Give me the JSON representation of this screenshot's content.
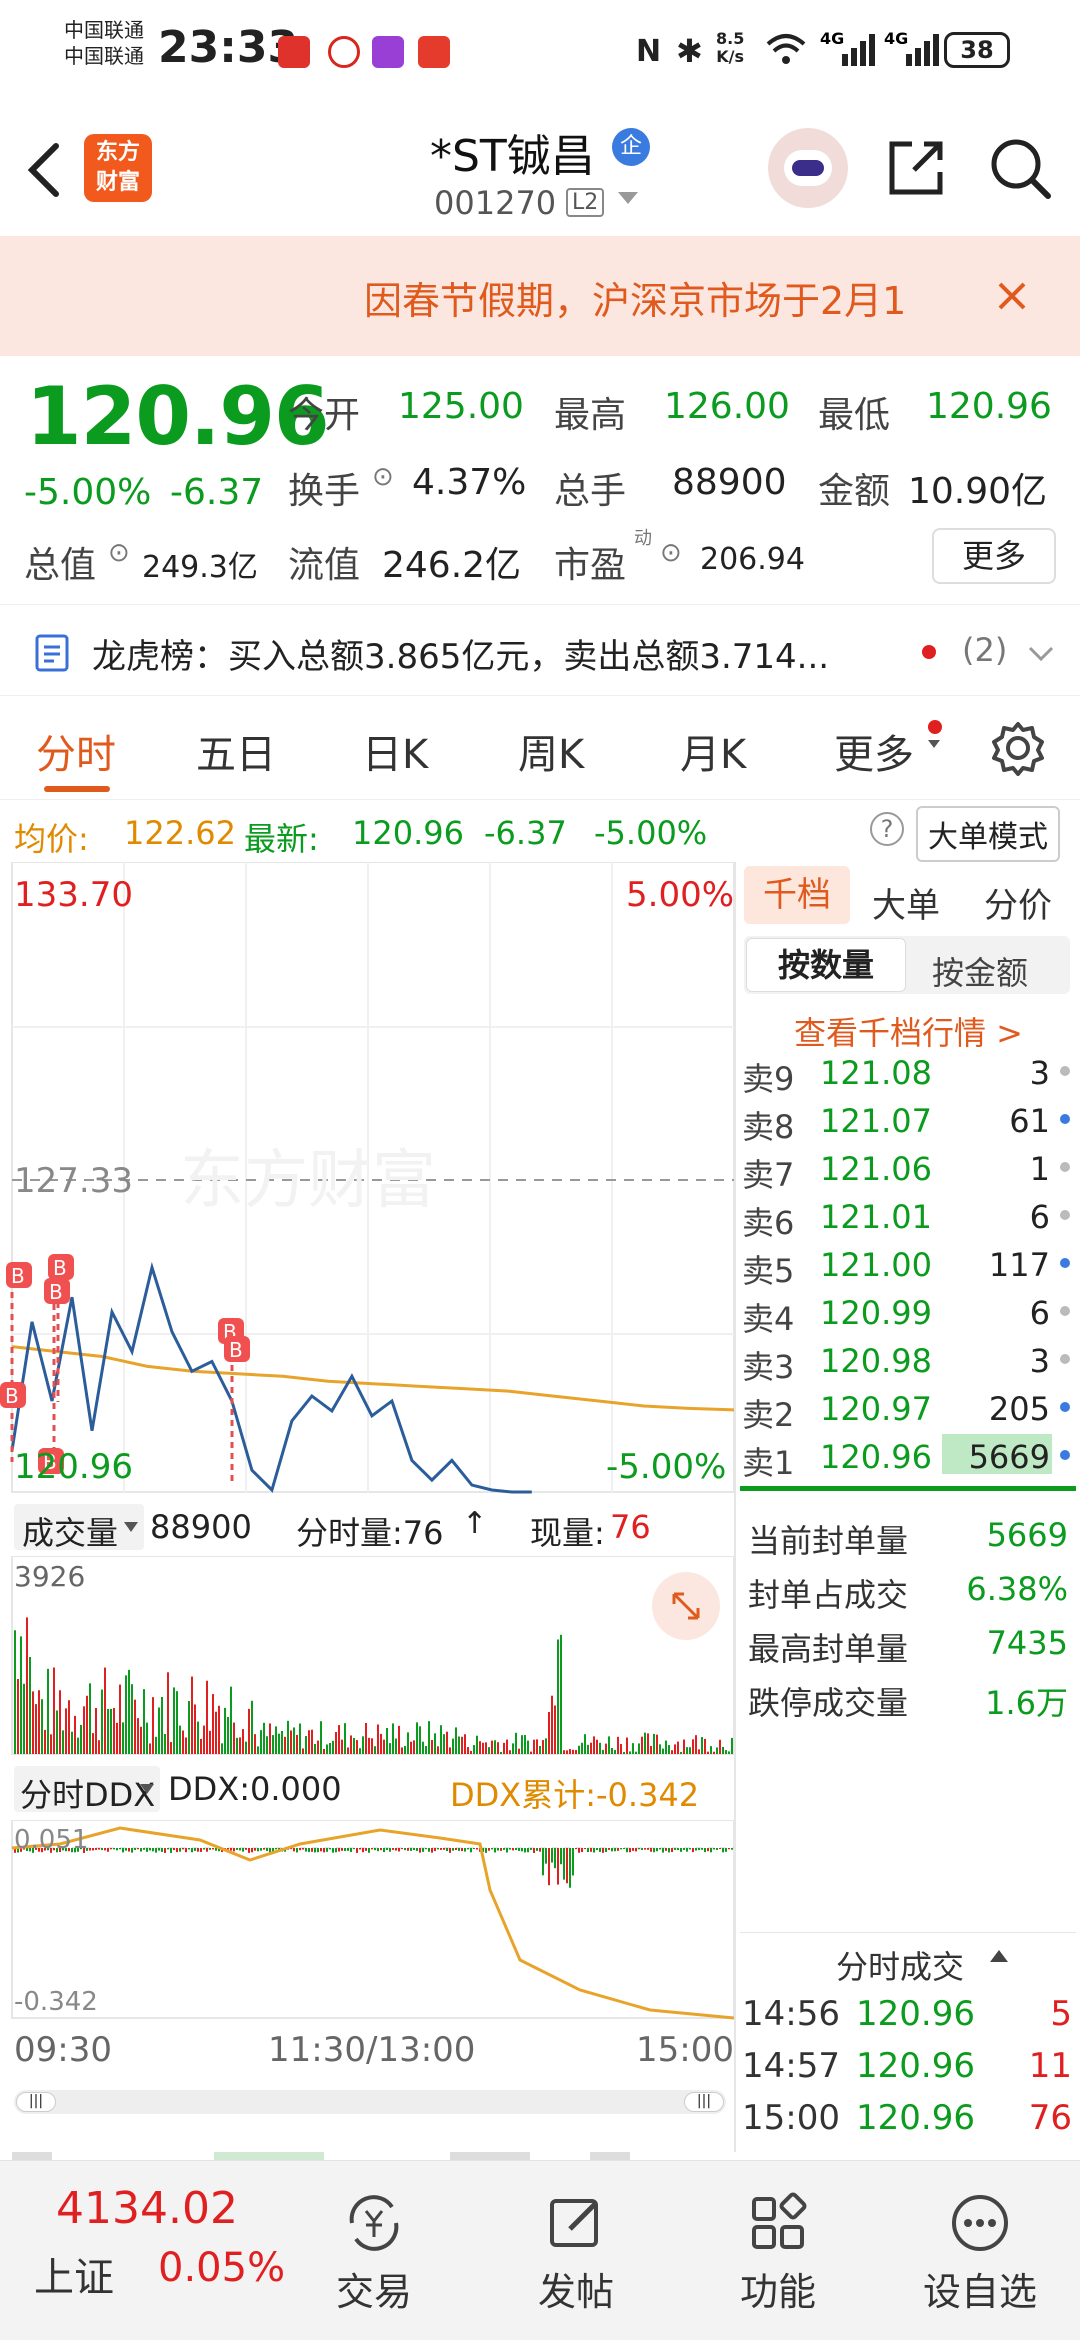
{
  "status": {
    "carrier1": "中国联通",
    "carrier2": "中国联通",
    "time": "23:33",
    "net_speed_top": "8.5",
    "net_speed_bot": "K/s",
    "battery": "38"
  },
  "header": {
    "logo_line1": "东方",
    "logo_line2": "财富",
    "name": "*ST铖昌",
    "enterprise_badge": "企",
    "code": "001270",
    "level": "L2"
  },
  "notice": {
    "text": "因春节假期，沪深京市场于2月1"
  },
  "quote": {
    "price": "120.96",
    "change_pct": "-5.00%",
    "change": "-6.37",
    "open_label": "今开",
    "open": "125.00",
    "high_label": "最高",
    "high": "126.00",
    "low_label": "最低",
    "low": "120.96",
    "turnover_label": "换手",
    "turnover": "4.37%",
    "volume_label": "总手",
    "volume": "88900",
    "amount_label": "金额",
    "amount": "10.90亿",
    "mktcap_label": "总值",
    "mktcap": "249.3亿",
    "float_label": "流值",
    "float_cap": "246.2亿",
    "pe_label": "市盈",
    "pe_sup": "动",
    "pe": "206.94",
    "more": "更多"
  },
  "lhb": {
    "text": "龙虎榜：买入总额3.865亿元，卖出总额3.714...",
    "count": "(2)"
  },
  "tabs": [
    "分时",
    "五日",
    "日K",
    "周K",
    "月K",
    "更多"
  ],
  "info": {
    "avg_label": "均价:",
    "avg": "122.62",
    "latest_label": "最新:",
    "latest": "120.96",
    "chg": "-6.37",
    "pct": "-5.00%",
    "mode": "大单模式"
  },
  "chart": {
    "top_price": "133.70",
    "top_pct": "5.00%",
    "mid_price": "127.33",
    "bottom_price": "120.96",
    "bottom_pct": "-5.00%",
    "watermark": "东方财富",
    "b_marker": "B",
    "vol_label": "成交量",
    "vol_total": "88900",
    "tick_vol_label": "分时量:76",
    "cur_vol_label": "现量:",
    "cur_vol": "76",
    "vol_max": "3926",
    "ddx_label": "分时DDX",
    "ddx": "DDX:0.000",
    "ddx_cum": "DDX累计:-0.342",
    "ddx_top": "0.051",
    "ddx_bottom": "-0.342",
    "time_start": "09:30",
    "time_mid": "11:30/13:00",
    "time_end": "15:00"
  },
  "chart_data": {
    "type": "line",
    "x_ticks": [
      "09:30",
      "11:30/13:00",
      "15:00"
    ],
    "ylim": [
      120.96,
      133.7
    ],
    "y_ref": 127.33,
    "series": [
      {
        "values": [
          121.8,
          124.4,
          122.8,
          124.9,
          122.2,
          124.6,
          123.8,
          125.5,
          124.2,
          123.4,
          123.6,
          122.8,
          121.4,
          121.0,
          122.4,
          122.9,
          122.6,
          123.3,
          122.5,
          122.8,
          121.6,
          121.2,
          121.6,
          121.1,
          121.0,
          120.96,
          120.96
        ]
      },
      {
        "values": [
          123.9,
          123.8,
          123.7,
          123.5,
          123.4,
          123.35,
          123.3,
          123.2,
          123.15,
          123.1,
          123.05,
          123.0,
          122.9,
          122.8,
          122.7,
          122.65,
          122.62
        ]
      }
    ]
  },
  "orderbook": {
    "tabs": [
      "千档",
      "大单",
      "分价"
    ],
    "sub_tabs": [
      "按数量",
      "按金额"
    ],
    "link": "查看千档行情 >",
    "asks": [
      {
        "side": "卖9",
        "price": "121.08",
        "vol": "3",
        "dot": "#bbbbbb"
      },
      {
        "side": "卖8",
        "price": "121.07",
        "vol": "61",
        "dot": "#3a7be0"
      },
      {
        "side": "卖7",
        "price": "121.06",
        "vol": "1",
        "dot": "#bbbbbb"
      },
      {
        "side": "卖6",
        "price": "121.01",
        "vol": "6",
        "dot": "#bbbbbb"
      },
      {
        "side": "卖5",
        "price": "121.00",
        "vol": "117",
        "dot": "#3a7be0"
      },
      {
        "side": "卖4",
        "price": "120.99",
        "vol": "6",
        "dot": "#bbbbbb"
      },
      {
        "side": "卖3",
        "price": "120.98",
        "vol": "3",
        "dot": "#bbbbbb"
      },
      {
        "side": "卖2",
        "price": "120.97",
        "vol": "205",
        "dot": "#3a7be0"
      },
      {
        "side": "卖1",
        "price": "120.96",
        "vol": "5669",
        "dot": "#3a7be0"
      }
    ],
    "stats": [
      {
        "k": "当前封单量",
        "v": "5669"
      },
      {
        "k": "封单占成交",
        "v": "6.38%"
      },
      {
        "k": "最高封单量",
        "v": "7435"
      },
      {
        "k": "跌停成交量",
        "v": "1.6万"
      }
    ],
    "trades_title": "分时成交",
    "trades": [
      {
        "t": "14:56",
        "p": "120.96",
        "v": "5"
      },
      {
        "t": "14:57",
        "p": "120.96",
        "v": "11"
      },
      {
        "t": "15:00",
        "p": "120.96",
        "v": "76"
      }
    ]
  },
  "bottom": {
    "index_value": "4134.02",
    "index_name": "上证",
    "index_pct": "0.05%",
    "nav": [
      "交易",
      "发帖",
      "功能",
      "设自选"
    ]
  }
}
